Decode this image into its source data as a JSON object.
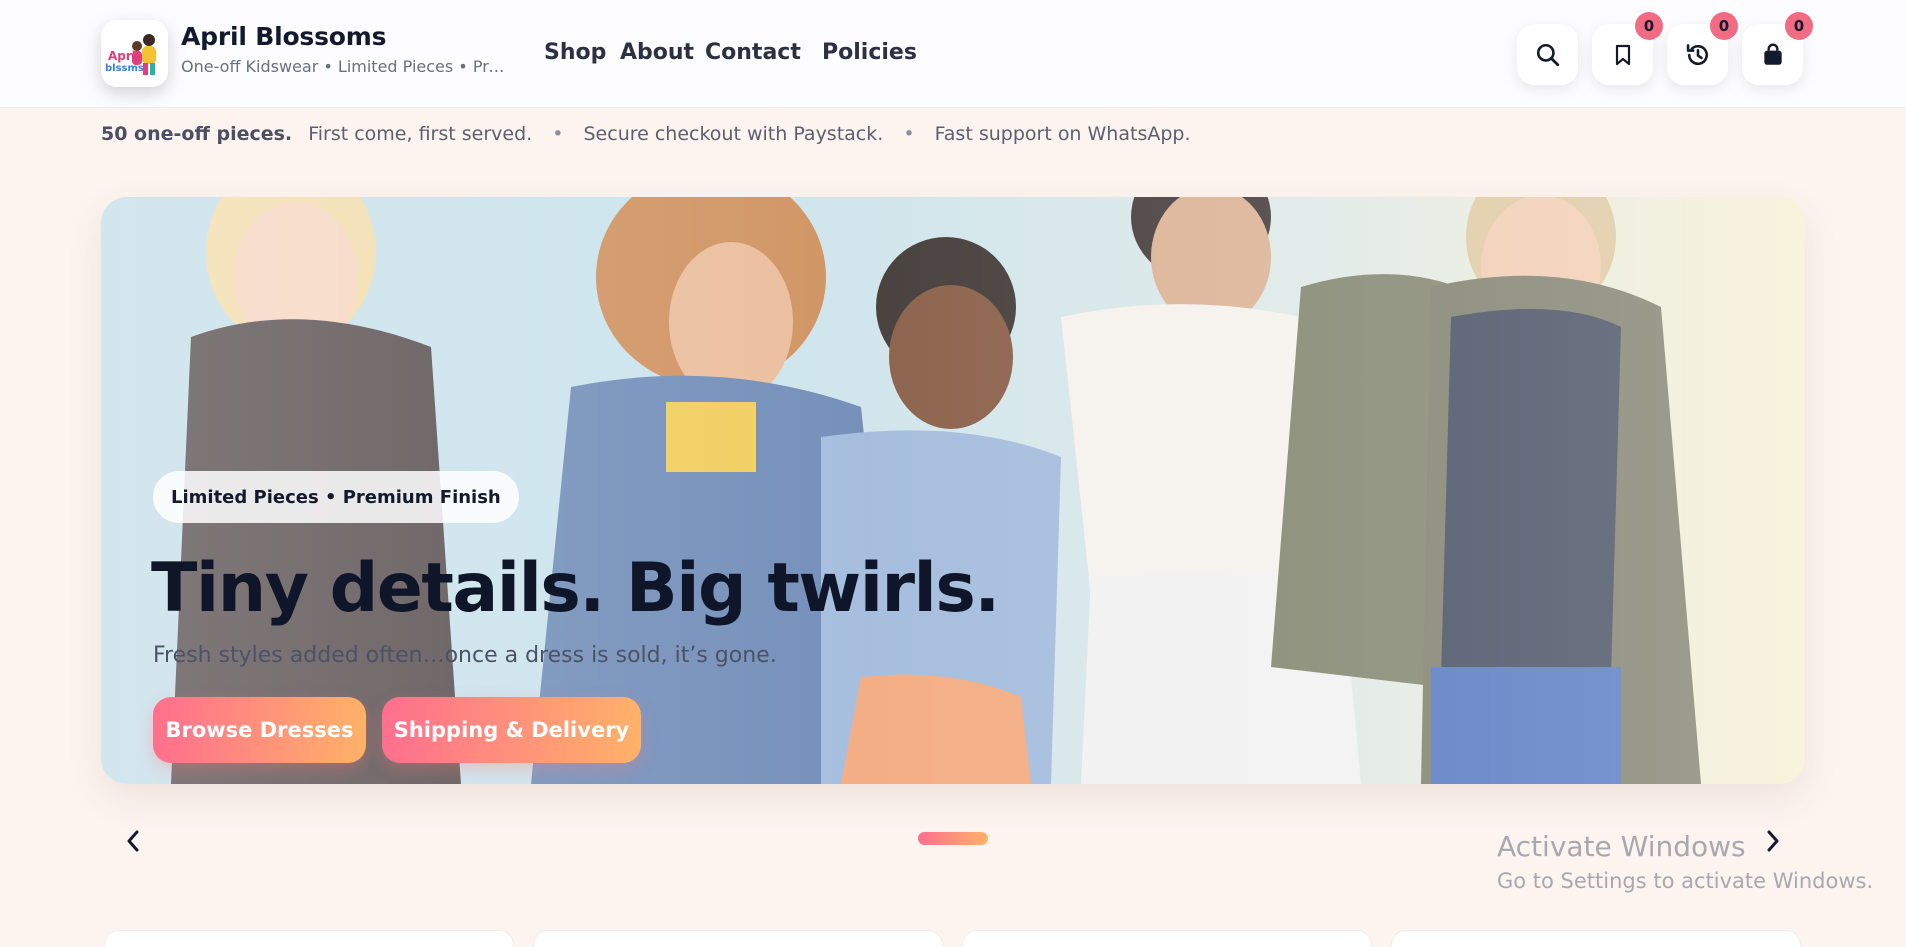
{
  "brand": {
    "title": "April Blossoms",
    "subtitle": "One-off Kidswear • Limited Pieces • Premium Finish",
    "logo_text": "April blossoms"
  },
  "nav": {
    "shop": "Shop",
    "about": "About",
    "contact": "Contact",
    "policies": "Policies"
  },
  "actions": {
    "search_icon": "search-icon",
    "wishlist_icon": "bookmark-icon",
    "wishlist_count": "0",
    "history_icon": "history-icon",
    "history_count": "0",
    "bag_icon": "shopping-bag-icon",
    "bag_count": "0"
  },
  "announcement": {
    "strong": "50 one-off pieces.",
    "item1": "First come, first served.",
    "item2": "Secure checkout with Paystack.",
    "item3": "Fast support on WhatsApp.",
    "separator": "•"
  },
  "hero": {
    "pill": "Limited Pieces • Premium Finish",
    "title": "Tiny details. Big twirls.",
    "subtitle": "Fresh styles added often…once a dress is sold, it’s gone.",
    "cta_primary": "Browse Dresses",
    "cta_secondary": "Shipping & Delivery"
  },
  "carousel": {
    "prev_icon": "chevron-left-icon",
    "next_icon": "chevron-right-icon",
    "slide_count": 1,
    "active_index": 0
  },
  "os_watermark": {
    "line1": "Activate Windows",
    "line2": "Go to Settings to activate Windows."
  },
  "colors": {
    "accent_start": "#ff6f8e",
    "accent_end": "#ffb268",
    "badge": "#f26b83",
    "text_dark": "#141a2e",
    "page_bg": "#fdf4ef"
  }
}
